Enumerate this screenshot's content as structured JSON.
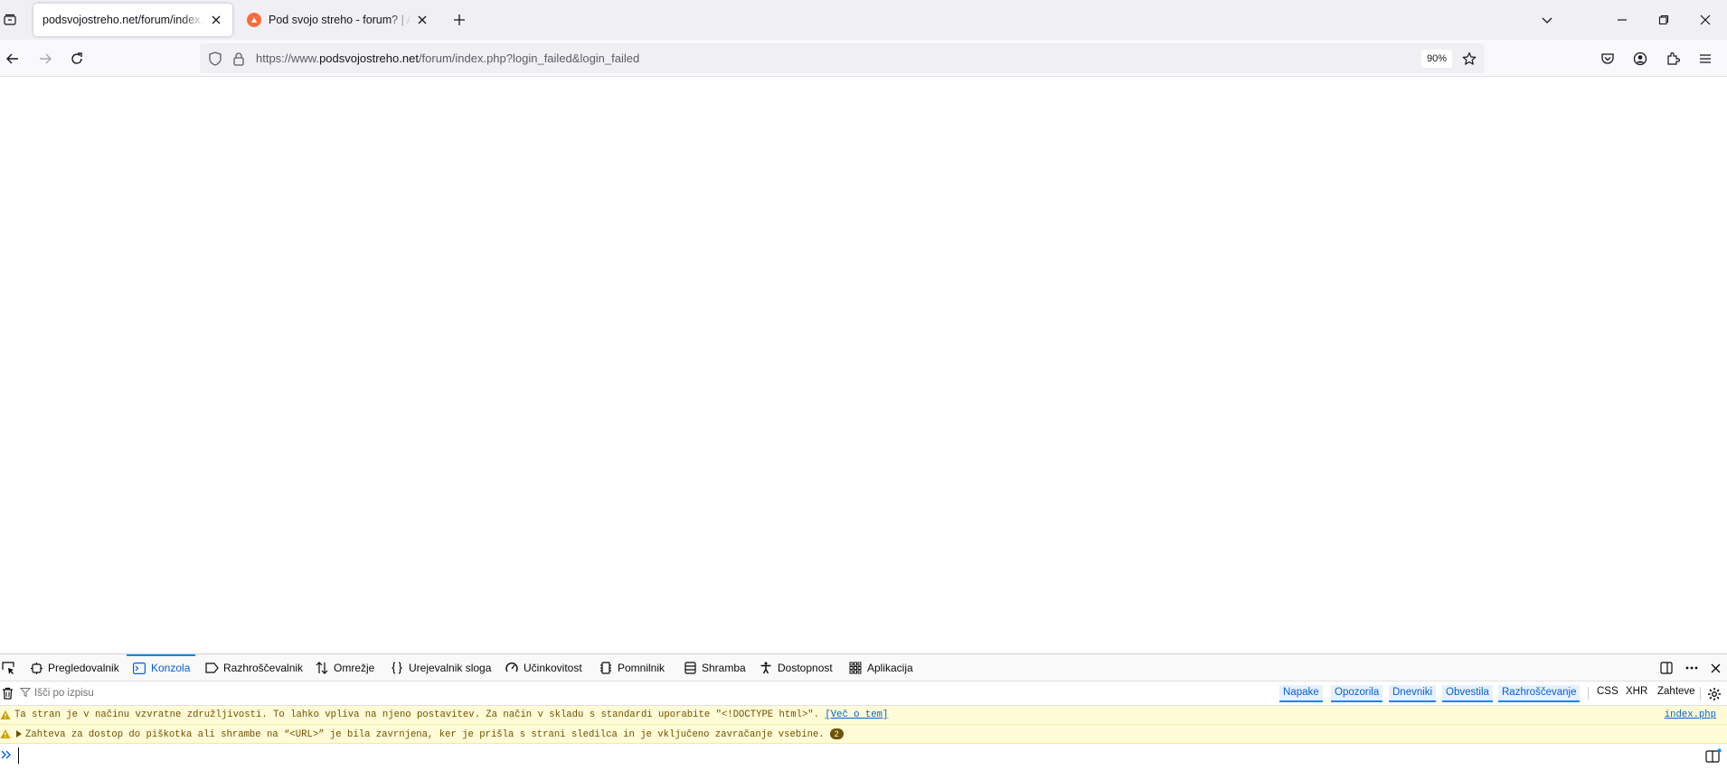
{
  "browser": {
    "tabs": [
      {
        "title": "podsvojostreho.net/forum/index.php?login_failed&login_failed",
        "active": true
      },
      {
        "title": "Pod svojo streho - forum? | Alternativa za kredite",
        "active": false,
        "favicon_color": "#ff6a3d"
      }
    ],
    "url": {
      "prefix": "https://www.",
      "domain": "podsvojostreho.net",
      "path": "/forum/index.php?login_failed&login_failed"
    },
    "zoom": "90%"
  },
  "devtools": {
    "tabs": [
      {
        "label": "Pregledovalnik",
        "icon": "inspector-icon",
        "selected": false
      },
      {
        "label": "Konzola",
        "icon": "console-icon",
        "selected": true
      },
      {
        "label": "Razhroščevalnik",
        "icon": "debugger-icon",
        "selected": false
      },
      {
        "label": "Omrežje",
        "icon": "network-icon",
        "selected": false
      },
      {
        "label": "Urejevalnik sloga",
        "icon": "style-editor-icon",
        "selected": false
      },
      {
        "label": "Učinkovitost",
        "icon": "performance-icon",
        "selected": false
      },
      {
        "label": "Pomnilnik",
        "icon": "memory-icon",
        "selected": false
      },
      {
        "label": "Shramba",
        "icon": "storage-icon",
        "selected": false
      },
      {
        "label": "Dostopnost",
        "icon": "accessibility-icon",
        "selected": false
      },
      {
        "label": "Aplikacija",
        "icon": "application-icon",
        "selected": false
      }
    ],
    "filter_placeholder": "Išči po izpisu",
    "levels": [
      "Napake",
      "Opozorila",
      "Dnevniki",
      "Obvestila",
      "Razhroščevanje"
    ],
    "net_filters": [
      "CSS",
      "XHR",
      "Zahteve"
    ],
    "messages": [
      {
        "level": "warning",
        "text": "Ta stran je v načinu vzvratne združljivosti. To lahko vpliva na njeno postavitev. Za način v skladu s standardi uporabite \"<!DOCTYPE html>\".",
        "link": "[Več o tem]",
        "source": "index.php"
      },
      {
        "level": "warning",
        "text": "Zahteva za dostop do piškotka ali shrambe na “<URL>” je bila zavrnjena, ker je prišla s strani sledilca in je vključeno zavračanje vsebine.",
        "count": "2"
      }
    ],
    "input_value": ""
  }
}
